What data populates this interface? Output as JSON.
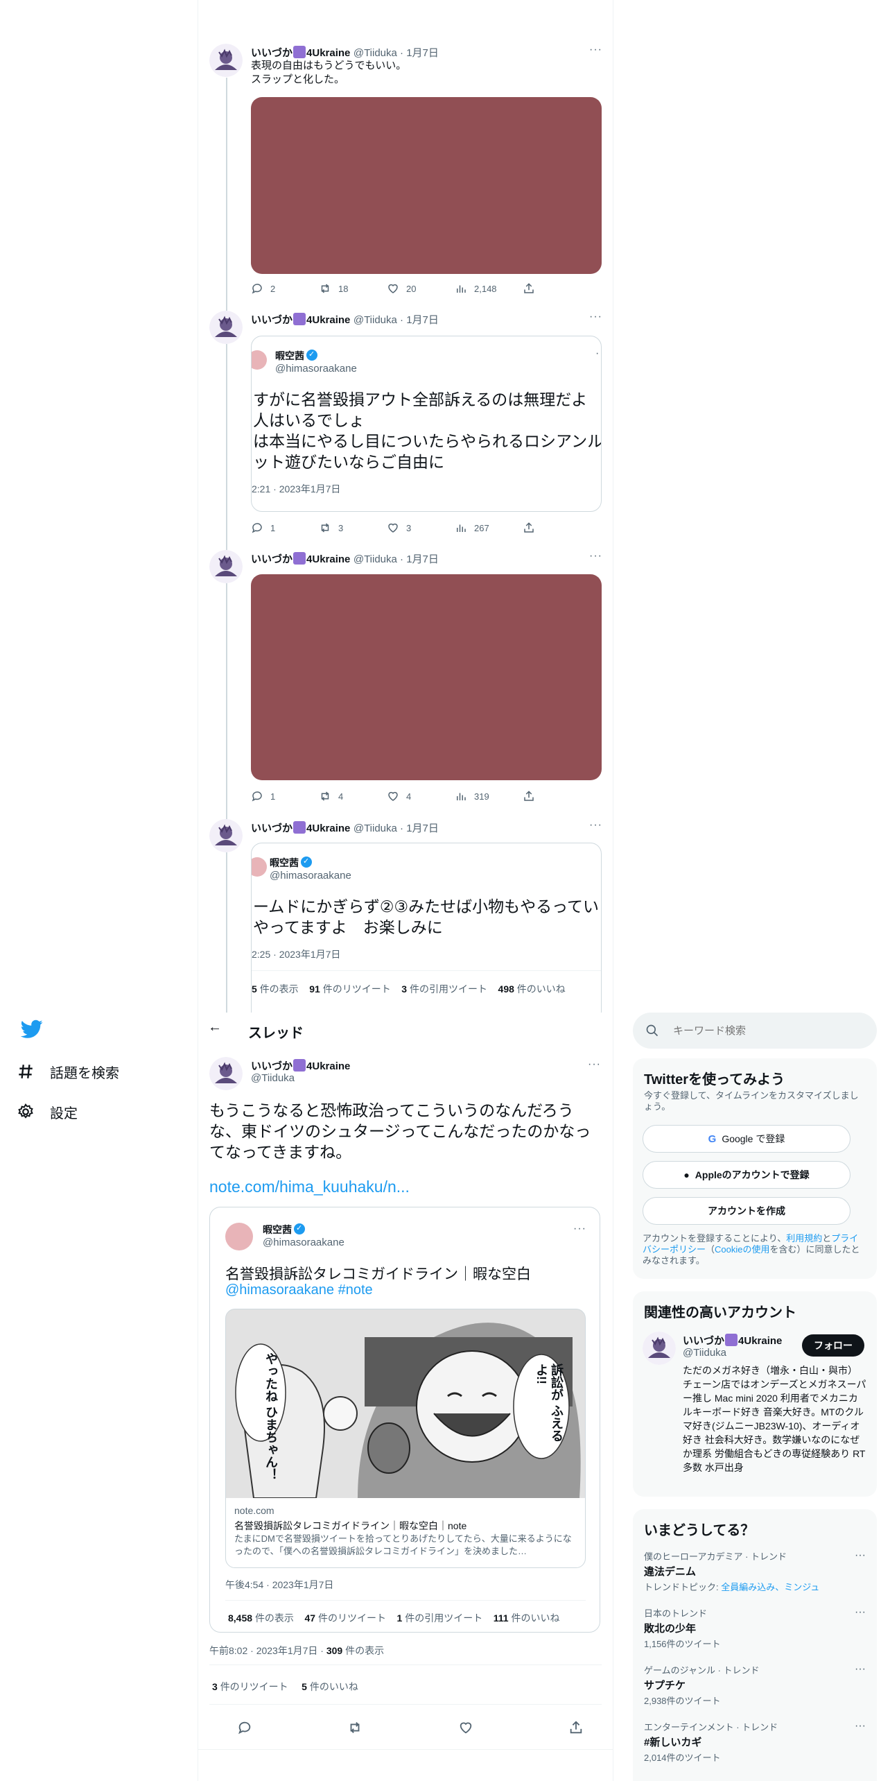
{
  "colors": {
    "accent": "#1d9bf0",
    "media": "#914f54",
    "text": "#0f1419",
    "muted": "#536471"
  },
  "thread_tweets": [
    {
      "name": "いいづか",
      "name_suffix": "4Ukraine",
      "handle": "@Tiiduka",
      "date": "1月7日",
      "text_lines": [
        "表現の自由はもうどうでもいい。",
        "スラップと化した。"
      ],
      "replies": "2",
      "retweets": "18",
      "likes": "20",
      "views": "2,148"
    },
    {
      "name": "いいづか",
      "name_suffix": "4Ukraine",
      "handle": "@Tiiduka",
      "date": "1月7日",
      "quote": {
        "name": "暇空茜",
        "handle": "@himasoraakane",
        "lines": [
          "すがに名誉毀損アウト全部訴えるのは無理だよ",
          "人はいるでしょ",
          "は本当にやるし目についたらやられるロシアンルー",
          "ット遊びたいならご自由に"
        ],
        "time": "2:21 · 2023年1月7日"
      },
      "replies": "1",
      "retweets": "3",
      "likes": "3",
      "views": "267"
    },
    {
      "name": "いいづか",
      "name_suffix": "4Ukraine",
      "handle": "@Tiiduka",
      "date": "1月7日",
      "replies": "1",
      "retweets": "4",
      "likes": "4",
      "views": "319"
    },
    {
      "name": "いいづか",
      "name_suffix": "4Ukraine",
      "handle": "@Tiiduka",
      "date": "1月7日",
      "quote": {
        "name": "暇空茜",
        "handle": "@himasoraakane",
        "lines": [
          "ームドにかぎらず②③みたせば小物もやるってい",
          "やってますよ　お楽しみに"
        ],
        "time": "2:25 · 2023年1月7日",
        "stats": [
          {
            "n": "5",
            "l": "件の表示"
          },
          {
            "n": "91",
            "l": "件のリツイート"
          },
          {
            "n": "3",
            "l": "件の引用ツイート"
          },
          {
            "n": "498",
            "l": "件のいいね"
          }
        ]
      }
    }
  ],
  "nav": {
    "explore": "話題を検索",
    "settings": "設定"
  },
  "header": {
    "title": "スレッド",
    "back": "←"
  },
  "main_tweet": {
    "name": "いいづか",
    "name_suffix": "4Ukraine",
    "handle": "@Tiiduka",
    "text": "もうこうなると恐怖政治ってこういうのなんだろうな、東ドイツのシュタージってこんなだったのかなってなってきますね。",
    "link": "note.com/hima_kuuhaku/n...",
    "quote": {
      "name": "暇空茜",
      "handle": "@himasoraakane",
      "title": "名誉毀損訴訟タレコミガイドライン｜暇な空白",
      "tags": "@himasoraakane #note",
      "card_domain": "note.com",
      "card_title": "名誉毀損訴訟タレコミガイドライン｜暇な空白｜note",
      "card_desc": "たまにDMで名誉毀損ツイートを拾ってとりあげたりしてたら、大量に来るようになったので、「僕への名誉毀損訴訟タレコミガイドライン」を決めました…",
      "manga_left": "やったね ひまちゃん！",
      "manga_right": "訴訟が ふえるよ!!",
      "time": "午後4:54 · 2023年1月7日",
      "stats": [
        {
          "n": "8,458",
          "l": "件の表示"
        },
        {
          "n": "47",
          "l": "件のリツイート"
        },
        {
          "n": "1",
          "l": "件の引用ツイート"
        },
        {
          "n": "111",
          "l": "件のいいね"
        }
      ]
    },
    "time": "午前8:02 · 2023年1月7日 · ",
    "views_n": "309",
    "views_l": "件の表示",
    "rt_n": "3",
    "rt_l": "件のリツイート",
    "like_n": "5",
    "like_l": "件のいいね"
  },
  "search": {
    "placeholder": "キーワード検索"
  },
  "signup": {
    "title": "Twitterを使ってみよう",
    "sub": "今すぐ登録して、タイムラインをカスタマイズしましょう。",
    "google": "Google で登録",
    "apple": "Appleのアカウントで登録",
    "create": "アカウントを作成",
    "terms_a": "アカウントを登録することにより、",
    "terms_link1": "利用規約",
    "terms_b": "と",
    "terms_link2": "プライバシーポリシー",
    "terms_c": "（",
    "terms_link3": "Cookieの使用",
    "terms_d": "を含む）に同意したとみなされます。"
  },
  "related": {
    "title": "関連性の高いアカウント",
    "name": "いいづか",
    "name_suffix": "4Ukraine",
    "handle": "@Tiiduka",
    "follow": "フォロー",
    "bio": "ただのメガネ好き（増永・白山・與市） チェーン店ではオンデーズとメガネスーパー推し Mac mini 2020 利用者でメカニカルキーボード好き 音楽大好き。MTのクルマ好き(ジムニーJB23W-10)、オーディオ好き 社会科大好き。数学嫌いなのになぜか理系 労働組合もどきの専従経験あり RT多数 水戸出身"
  },
  "trends": {
    "title": "いまどうしてる？",
    "items": [
      {
        "meta": "僕のヒーローアカデミア · トレンド",
        "title": "違法デニム",
        "extra_pre": "トレンドトピック: ",
        "extra_link": "全員編み込み、ミンジュ"
      },
      {
        "meta": "日本のトレンド",
        "title": "敗北の少年",
        "count": "1,156件のツイート"
      },
      {
        "meta": "ゲームのジャンル · トレンド",
        "title": "サプチケ",
        "count": "2,938件のツイート"
      },
      {
        "meta": "エンターテインメント · トレンド",
        "title": "#新しいカギ",
        "count": "2,014件のツイート"
      }
    ]
  }
}
